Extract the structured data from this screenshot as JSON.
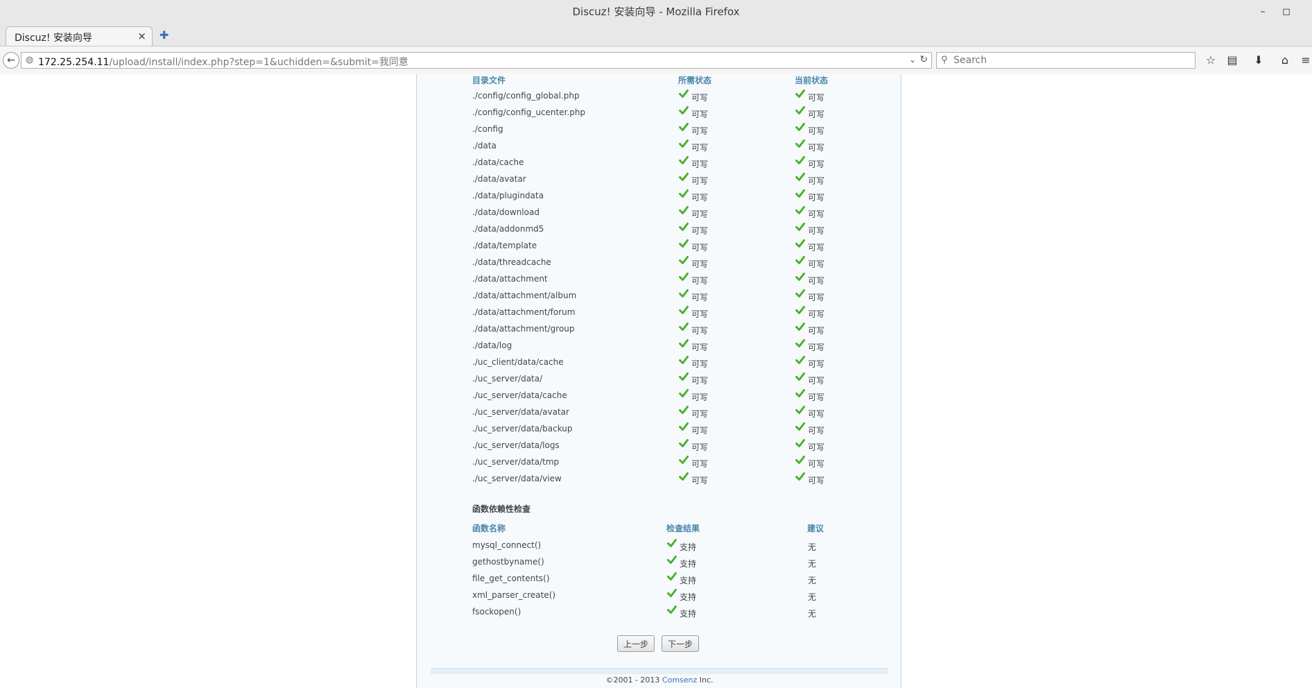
{
  "window": {
    "title": "Discuz! 安装向导 - Mozilla Firefox",
    "minimize": "–",
    "maximize": "◻"
  },
  "tab": {
    "title": "Discuz! 安装向导",
    "close": "×",
    "new": "✚"
  },
  "nav": {
    "url_host": "172.25.254.11",
    "url_path": "/upload/install/index.php?step=1&uchidden=&submit=我同意",
    "search_placeholder": "Search"
  },
  "dir_check": {
    "headers": {
      "name": "目录文件",
      "required": "所需状态",
      "current": "当前状态"
    },
    "rows": [
      {
        "name": "./config/config_global.php",
        "required": "可写",
        "current": "可写"
      },
      {
        "name": "./config/config_ucenter.php",
        "required": "可写",
        "current": "可写"
      },
      {
        "name": "./config",
        "required": "可写",
        "current": "可写"
      },
      {
        "name": "./data",
        "required": "可写",
        "current": "可写"
      },
      {
        "name": "./data/cache",
        "required": "可写",
        "current": "可写"
      },
      {
        "name": "./data/avatar",
        "required": "可写",
        "current": "可写"
      },
      {
        "name": "./data/plugindata",
        "required": "可写",
        "current": "可写"
      },
      {
        "name": "./data/download",
        "required": "可写",
        "current": "可写"
      },
      {
        "name": "./data/addonmd5",
        "required": "可写",
        "current": "可写"
      },
      {
        "name": "./data/template",
        "required": "可写",
        "current": "可写"
      },
      {
        "name": "./data/threadcache",
        "required": "可写",
        "current": "可写"
      },
      {
        "name": "./data/attachment",
        "required": "可写",
        "current": "可写"
      },
      {
        "name": "./data/attachment/album",
        "required": "可写",
        "current": "可写"
      },
      {
        "name": "./data/attachment/forum",
        "required": "可写",
        "current": "可写"
      },
      {
        "name": "./data/attachment/group",
        "required": "可写",
        "current": "可写"
      },
      {
        "name": "./data/log",
        "required": "可写",
        "current": "可写"
      },
      {
        "name": "./uc_client/data/cache",
        "required": "可写",
        "current": "可写"
      },
      {
        "name": "./uc_server/data/",
        "required": "可写",
        "current": "可写"
      },
      {
        "name": "./uc_server/data/cache",
        "required": "可写",
        "current": "可写"
      },
      {
        "name": "./uc_server/data/avatar",
        "required": "可写",
        "current": "可写"
      },
      {
        "name": "./uc_server/data/backup",
        "required": "可写",
        "current": "可写"
      },
      {
        "name": "./uc_server/data/logs",
        "required": "可写",
        "current": "可写"
      },
      {
        "name": "./uc_server/data/tmp",
        "required": "可写",
        "current": "可写"
      },
      {
        "name": "./uc_server/data/view",
        "required": "可写",
        "current": "可写"
      }
    ]
  },
  "func_check": {
    "title": "函数依赖性检查",
    "headers": {
      "name": "函数名称",
      "result": "检查结果",
      "advice": "建议"
    },
    "rows": [
      {
        "name": "mysql_connect()",
        "result": "支持",
        "advice": "无"
      },
      {
        "name": "gethostbyname()",
        "result": "支持",
        "advice": "无"
      },
      {
        "name": "file_get_contents()",
        "result": "支持",
        "advice": "无"
      },
      {
        "name": "xml_parser_create()",
        "result": "支持",
        "advice": "无"
      },
      {
        "name": "fsockopen()",
        "result": "支持",
        "advice": "无"
      }
    ]
  },
  "buttons": {
    "prev": "上一步",
    "next": "下一步"
  },
  "footer": {
    "copyright": "©2001 - 2013 ",
    "company": "Comsenz",
    "suffix": " Inc."
  },
  "colors": {
    "header_blue": "#4a86a8",
    "check_green": "#4ab02e",
    "link_blue": "#3a6fb7"
  }
}
